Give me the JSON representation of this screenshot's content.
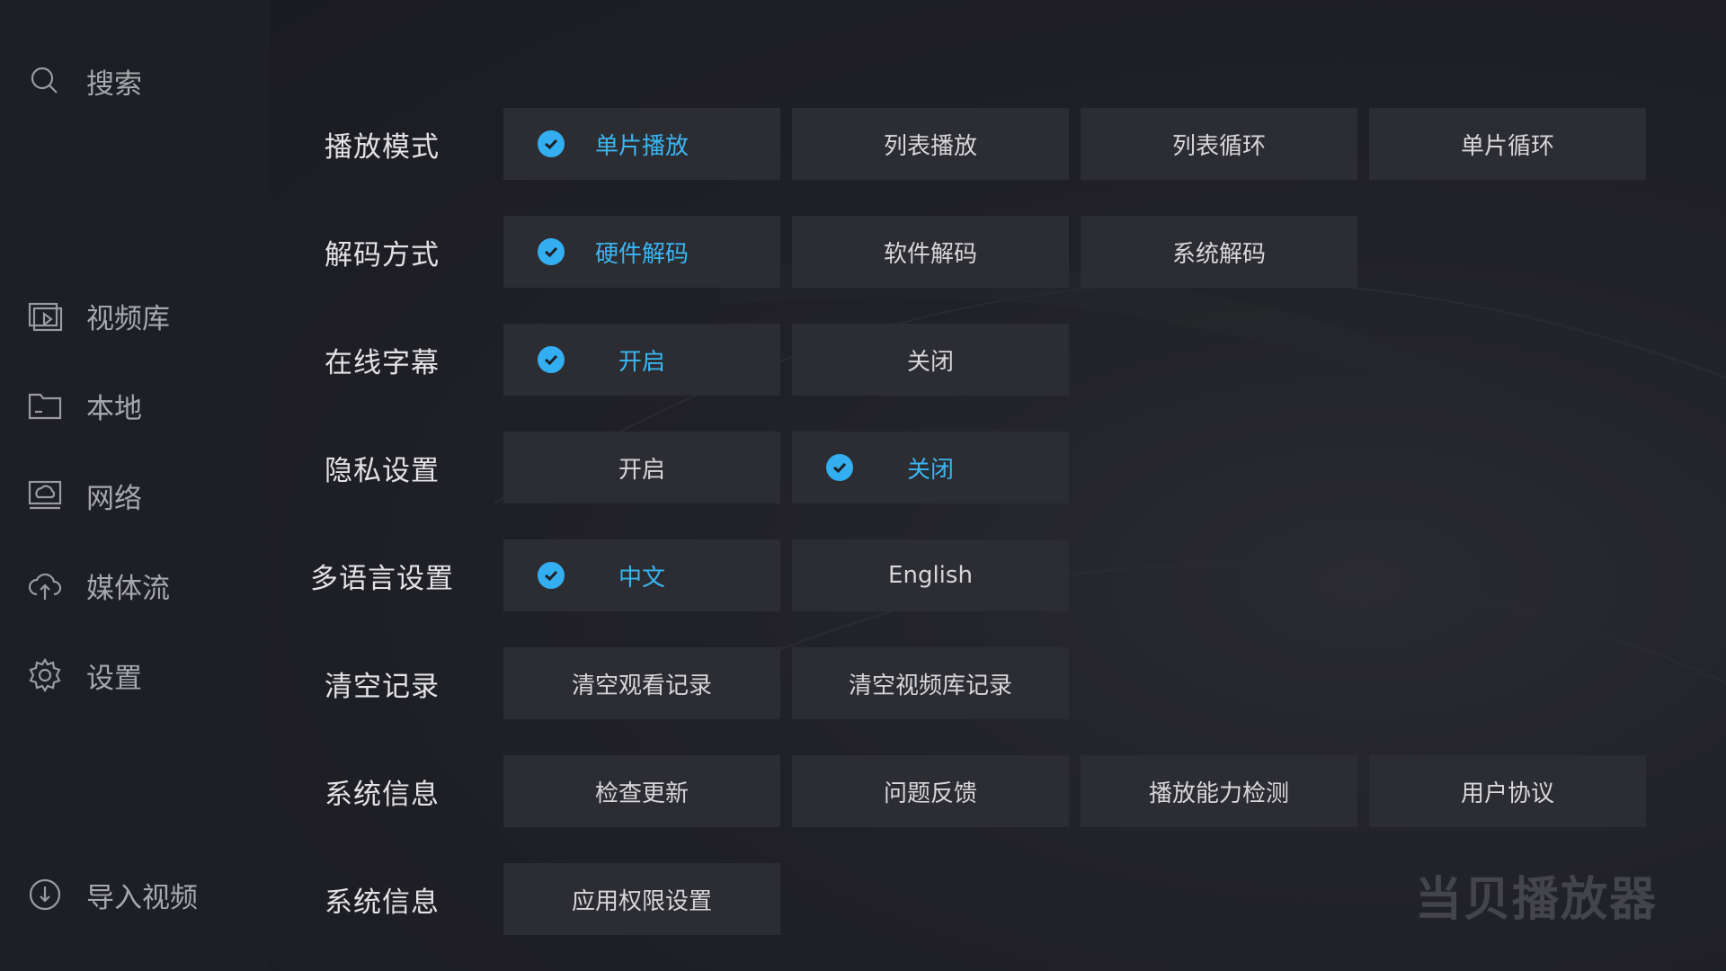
{
  "sidebar": {
    "search": {
      "label": "搜索",
      "icon": "search-icon"
    },
    "items": [
      {
        "label": "视频库",
        "icon": "video-library-icon"
      },
      {
        "label": "本地",
        "icon": "folder-icon"
      },
      {
        "label": "网络",
        "icon": "network-drive-icon"
      },
      {
        "label": "媒体流",
        "icon": "cloud-upload-icon"
      },
      {
        "label": "设置",
        "icon": "gear-icon"
      }
    ],
    "import": {
      "label": "导入视频",
      "icon": "download-circle-icon"
    }
  },
  "colors": {
    "accent": "#3ab6f2",
    "check_bg": "#33aef0",
    "option_bg": "#2c2d33"
  },
  "settings": [
    {
      "label": "播放模式",
      "options": [
        "单片播放",
        "列表播放",
        "列表循环",
        "单片循环"
      ],
      "selected": 0
    },
    {
      "label": "解码方式",
      "options": [
        "硬件解码",
        "软件解码",
        "系统解码"
      ],
      "selected": 0
    },
    {
      "label": "在线字幕",
      "options": [
        "开启",
        "关闭"
      ],
      "selected": 0
    },
    {
      "label": "隐私设置",
      "options": [
        "开启",
        "关闭"
      ],
      "selected": 1
    },
    {
      "label": "多语言设置",
      "options": [
        "中文",
        "English"
      ],
      "selected": 0
    },
    {
      "label": "清空记录",
      "options": [
        "清空观看记录",
        "清空视频库记录"
      ]
    },
    {
      "label": "系统信息",
      "options": [
        "检查更新",
        "问题反馈",
        "播放能力检测",
        "用户协议"
      ]
    },
    {
      "label": "系统信息",
      "options": [
        "应用权限设置"
      ]
    }
  ],
  "watermark": "当贝播放器"
}
